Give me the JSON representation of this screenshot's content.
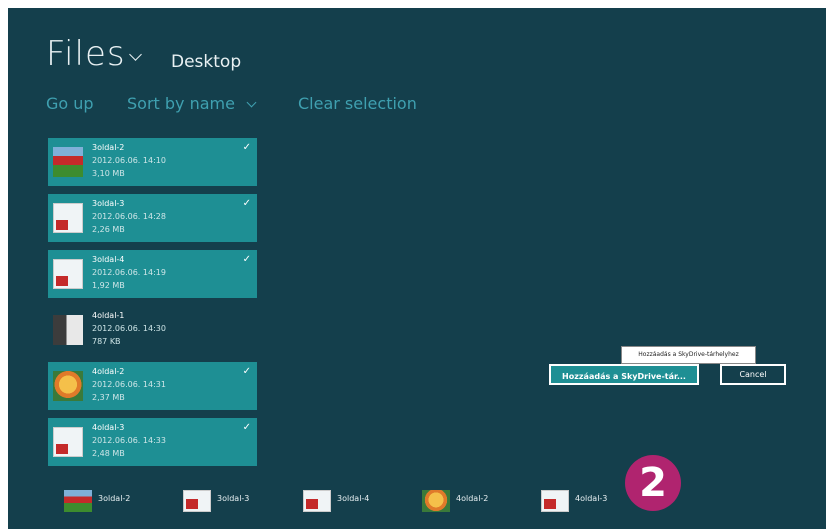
{
  "header": {
    "title": "Files",
    "location": "Desktop"
  },
  "commands": {
    "go_up": "Go up",
    "sort": "Sort by name",
    "clear": "Clear selection"
  },
  "files": [
    {
      "name": "3oldal-2",
      "date": "2012.06.06. 14:10",
      "size": "3,10 MB",
      "selected": true
    },
    {
      "name": "3oldal-3",
      "date": "2012.06.06. 14:28",
      "size": "2,26 MB",
      "selected": true
    },
    {
      "name": "3oldal-4",
      "date": "2012.06.06. 14:19",
      "size": "1,92 MB",
      "selected": true
    },
    {
      "name": "4oldal-1",
      "date": "2012.06.06. 14:30",
      "size": "787 KB",
      "selected": false
    },
    {
      "name": "4oldal-2",
      "date": "2012.06.06. 14:31",
      "size": "2,37 MB",
      "selected": true
    },
    {
      "name": "4oldal-3",
      "date": "2012.06.06. 14:33",
      "size": "2,48 MB",
      "selected": true
    }
  ],
  "actions": {
    "tooltip": "Hozzáadás a SkyDrive-tárhelyhez",
    "add_button": "Hozzáadás a SkyDrive-tár...",
    "cancel_button": "Cancel"
  },
  "tray": [
    {
      "name": "3oldal-2"
    },
    {
      "name": "3oldal-3"
    },
    {
      "name": "3oldal-4"
    },
    {
      "name": "4oldal-2"
    },
    {
      "name": "4oldal-3"
    }
  ],
  "badge": {
    "label": "2"
  },
  "colors": {
    "background": "#143f4c",
    "accent": "#1e8f94",
    "link": "#3fa0b0",
    "badge": "#b0246f"
  }
}
